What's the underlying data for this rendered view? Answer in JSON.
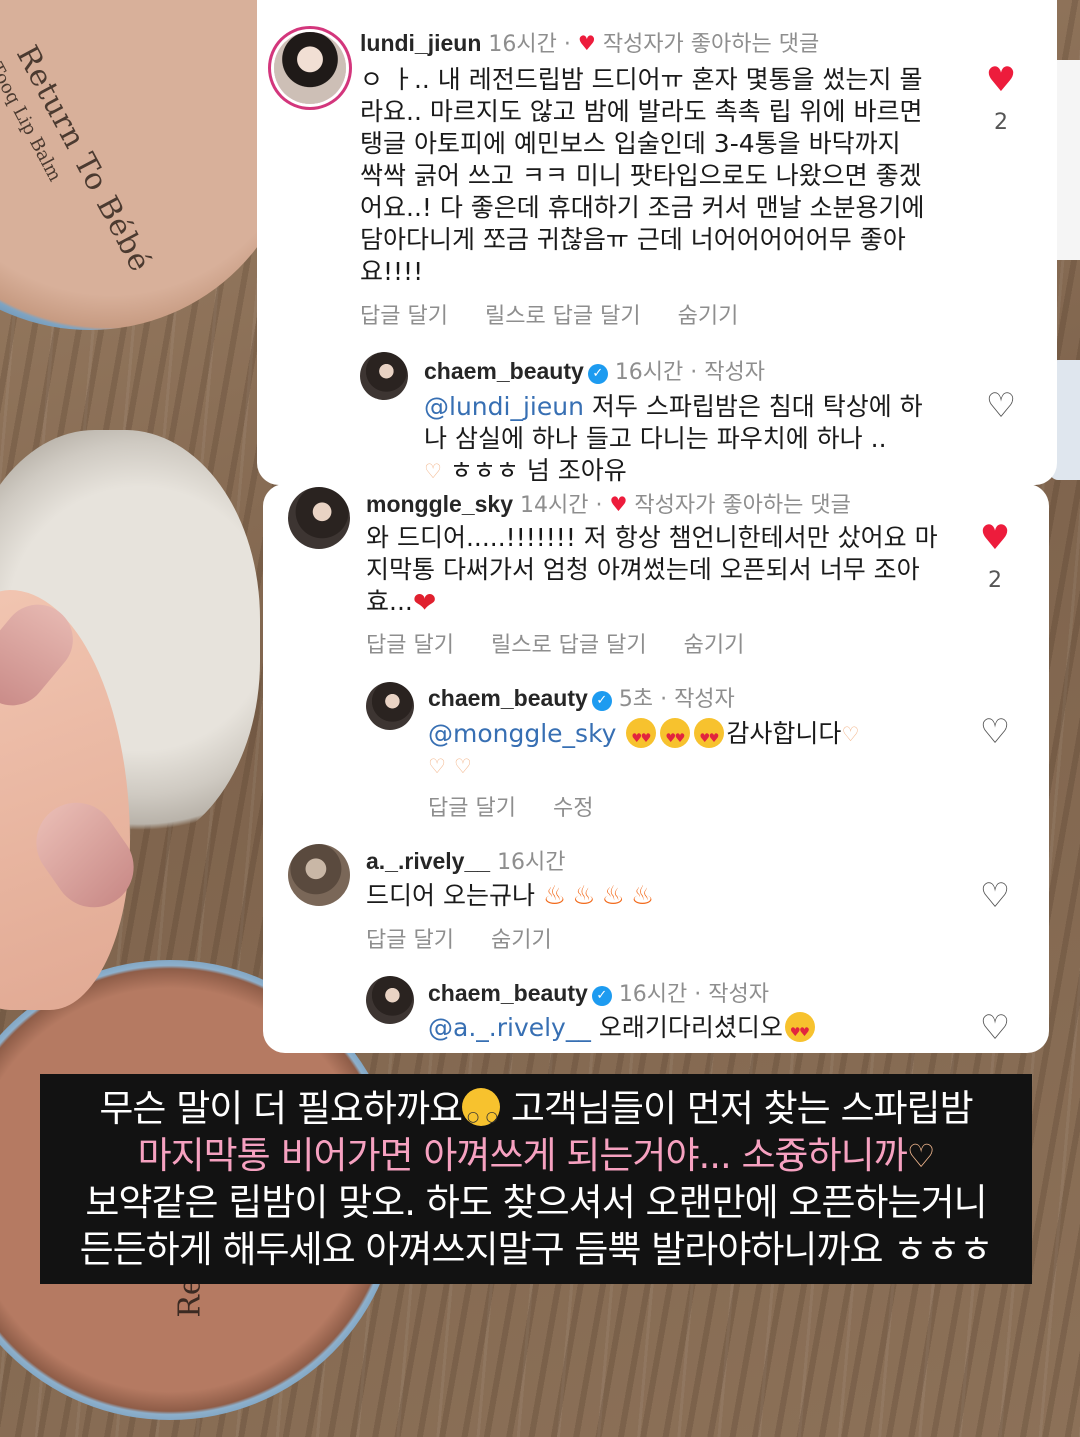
{
  "background": {
    "tin_top_title": "Return To Bébé",
    "tin_top_sub": "Tooq Lip Balm",
    "tin_bottom_text": "Re"
  },
  "comments": [
    {
      "username": "lundi_jieun",
      "time": "16시간",
      "badge": "작성자가 좋아하는 댓글",
      "text_lines": [
        "ㅇ ㅏ.. 내 레전드립밤 드디어ㅠ 혼자 몇통을 썼는지 몰",
        "라요.. 마르지도 않고 밤에 발라도 촉촉 립 위에 바르면",
        "탱글 아토피에 예민보스 입술인데 3-4통을 바닥까지",
        "싹싹 긁어 쓰고 ㅋㅋ 미니 팟타입으로도 나왔으면 좋겠",
        "어요..! 다 좋은데 휴대하기 조금 커서 맨날 소분용기에",
        "담아다니게 쪼금 귀찮음ㅠ 근데 너어어어어어무 좋아",
        "요!!!!"
      ],
      "actions": [
        "답글 달기",
        "릴스로 답글 달기",
        "숨기기"
      ],
      "likes": "2",
      "liked": true
    },
    {
      "username": "chaem_beauty",
      "time": "16시간",
      "author_label": "작성자",
      "mention": "@lundi_jieun",
      "text_first": "저두 스파립밤은 침대 탁상에 하",
      "text_lines": [
        "나 삼실에 하나 들고 다니는 파우치에 하나 ..",
        "ㅎㅎㅎ 넘 조아유"
      ],
      "liked": false
    },
    {
      "username": "monggle_sky",
      "time": "14시간",
      "badge": "작성자가 좋아하는 댓글",
      "text_lines": [
        "와 드디어.....!!!!!!! 저 항상 챔언니한테서만 샀어요 마",
        "지막통 다써가서 엄청 아껴썼는데 오픈되서 너무 조아",
        "효..."
      ],
      "actions": [
        "답글 달기",
        "릴스로 답글 달기",
        "숨기기"
      ],
      "likes": "2",
      "liked": true
    },
    {
      "username": "chaem_beauty",
      "time": "5초",
      "author_label": "작성자",
      "mention": "@monggle_sky",
      "text_first": "감사합니다",
      "actions": [
        "답글 달기",
        "수정"
      ],
      "liked": false
    },
    {
      "username": "a._.rively__",
      "time": "16시간",
      "text": "드디어 오는규나",
      "actions": [
        "답글 달기",
        "숨기기"
      ],
      "liked": false
    },
    {
      "username": "chaem_beauty",
      "time": "16시간",
      "author_label": "작성자",
      "mention": "@a._.rively__",
      "text": "오래기다리셨디오",
      "liked": false
    }
  ],
  "caption": {
    "line1": "무슨 말이 더 필요하까요",
    "line1b": "고객님들이 먼저 찾는 스파립밤",
    "line2": "마지막통 비어가면 아껴쓰게 되는거야... 소즁하니까",
    "line3": "보약같은 립밤이 맞오. 하도 찾으셔서 오랜만에 오픈하는거니",
    "line4": "든든하게 해두세요 아껴쓰지말구 듬뿍 발라야하니까요 ㅎㅎㅎ"
  },
  "colors": {
    "heart": "#ed1c3c",
    "mention": "#376fb3",
    "verified": "#1d9bf0",
    "caption_pink": "#f6a1c0"
  }
}
